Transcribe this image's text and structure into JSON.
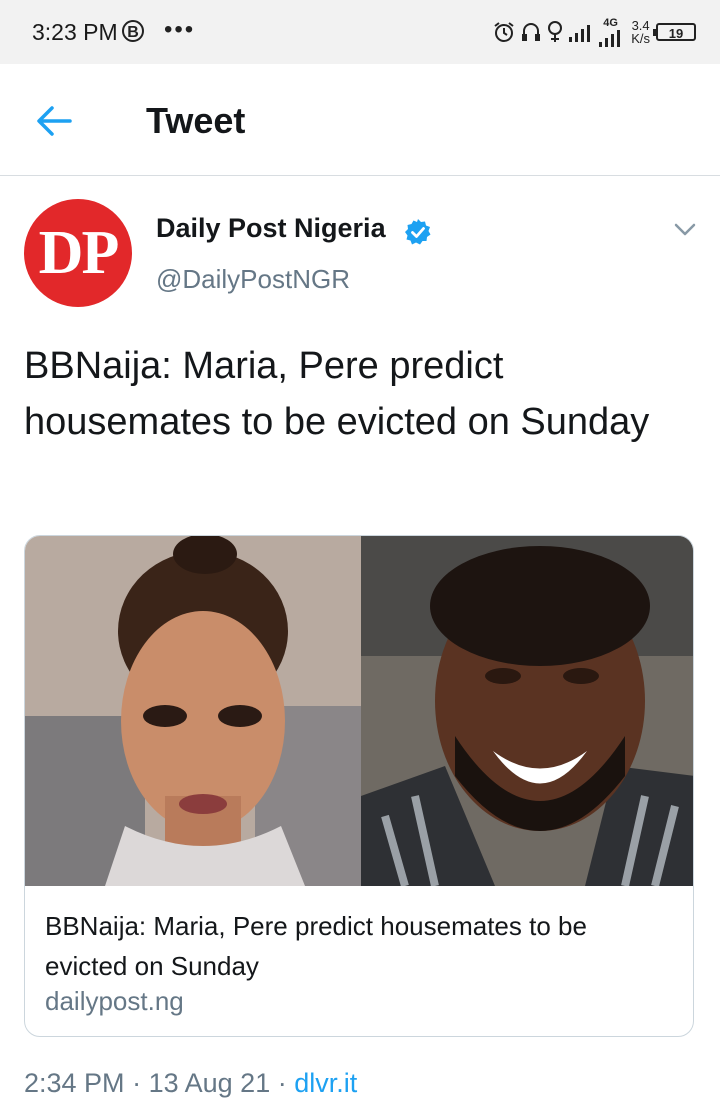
{
  "status_bar": {
    "time": "3:23 PM",
    "b_badge": "B",
    "dots": "•••",
    "network": "4G",
    "speed_value": "3.4",
    "speed_unit": "K/s",
    "battery": "19",
    "icons": [
      "alarm-icon",
      "headset-icon",
      "location-icon",
      "signal-icon",
      "signal-4g-icon",
      "battery-icon"
    ]
  },
  "header": {
    "title": "Tweet",
    "back_icon": "arrow-left-icon",
    "accent_color": "#1da1f2"
  },
  "tweet": {
    "author_name": "Daily Post Nigeria",
    "author_handle": "@DailyPostNGR",
    "avatar_text": "DP",
    "avatar_color": "#e2282a",
    "verified_icon": "verified-badge-icon",
    "text": "BBNaija: Maria, Pere predict housemates to be evicted on Sunday",
    "card": {
      "title": "BBNaija: Maria, Pere predict housemates to be evicted on Sunday",
      "domain": "dailypost.ng"
    },
    "time": "2:34 PM",
    "separator": "·",
    "date": "13 Aug 21",
    "source": "dlvr.it"
  }
}
